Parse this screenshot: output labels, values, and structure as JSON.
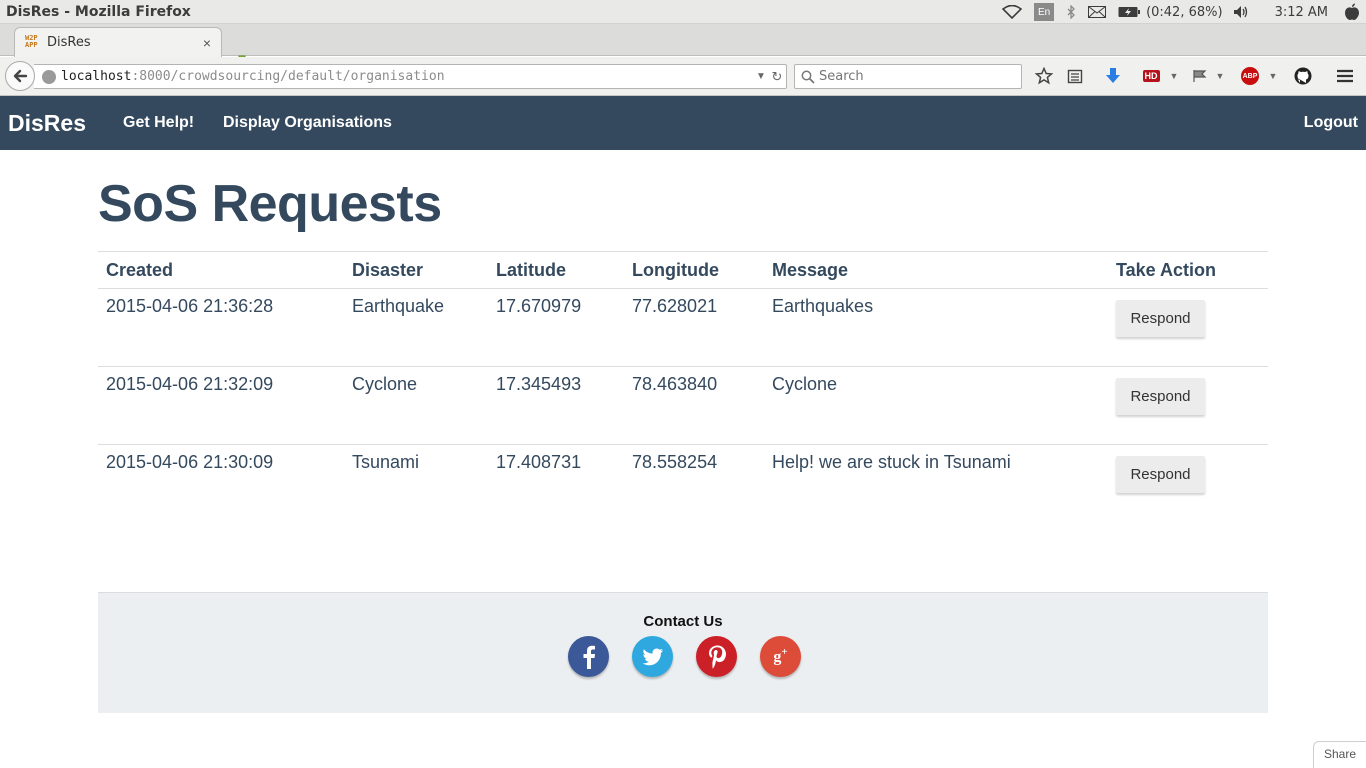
{
  "os": {
    "window_title": "DisRes - Mozilla Firefox",
    "keyboard_layout": "En",
    "battery": "(0:42, 68%)",
    "clock": "3:12 AM"
  },
  "browser": {
    "tab_title": "DisRes",
    "tab_favicon_text": "W2P APP",
    "url_host": "localhost",
    "url_rest": ":8000/crowdsourcing/default/organisation",
    "search_placeholder": "Search",
    "toolbar_icons": [
      "bookmark-star-icon",
      "reading-list-icon",
      "download-arrow-icon",
      "hd-icon",
      "flag-icon",
      "abp-icon",
      "github-icon",
      "menu-icon"
    ],
    "hd_label": "HD",
    "abp_label": "ABP"
  },
  "navbar": {
    "brand": "DisRes",
    "links": [
      "Get Help!",
      "Display Organisations"
    ],
    "logout": "Logout",
    "color": "#34495e"
  },
  "main": {
    "title": "SoS Requests",
    "columns": [
      "Created",
      "Disaster",
      "Latitude",
      "Longitude",
      "Message",
      "Take Action"
    ],
    "rows": [
      {
        "created": "2015-04-06 21:36:28",
        "disaster": "Earthquake",
        "latitude": "17.670979",
        "longitude": "77.628021",
        "message": "Earthquakes",
        "action": "Respond"
      },
      {
        "created": "2015-04-06 21:32:09",
        "disaster": "Cyclone",
        "latitude": "17.345493",
        "longitude": "78.463840",
        "message": "Cyclone",
        "action": "Respond"
      },
      {
        "created": "2015-04-06 21:30:09",
        "disaster": "Tsunami",
        "latitude": "17.408731",
        "longitude": "78.558254",
        "message": "Help! we are stuck in Tsunami",
        "action": "Respond"
      }
    ]
  },
  "footer": {
    "contact_label": "Contact Us",
    "social": [
      {
        "name": "facebook-icon",
        "glyph": "f",
        "color": "#3b5998"
      },
      {
        "name": "twitter-icon",
        "glyph": "t",
        "color": "#2fa8e0"
      },
      {
        "name": "pinterest-icon",
        "glyph": "P",
        "color": "#cb2027"
      },
      {
        "name": "google-plus-icon",
        "glyph": "g+",
        "color": "#dd4b39"
      }
    ]
  },
  "share_label": "Share"
}
